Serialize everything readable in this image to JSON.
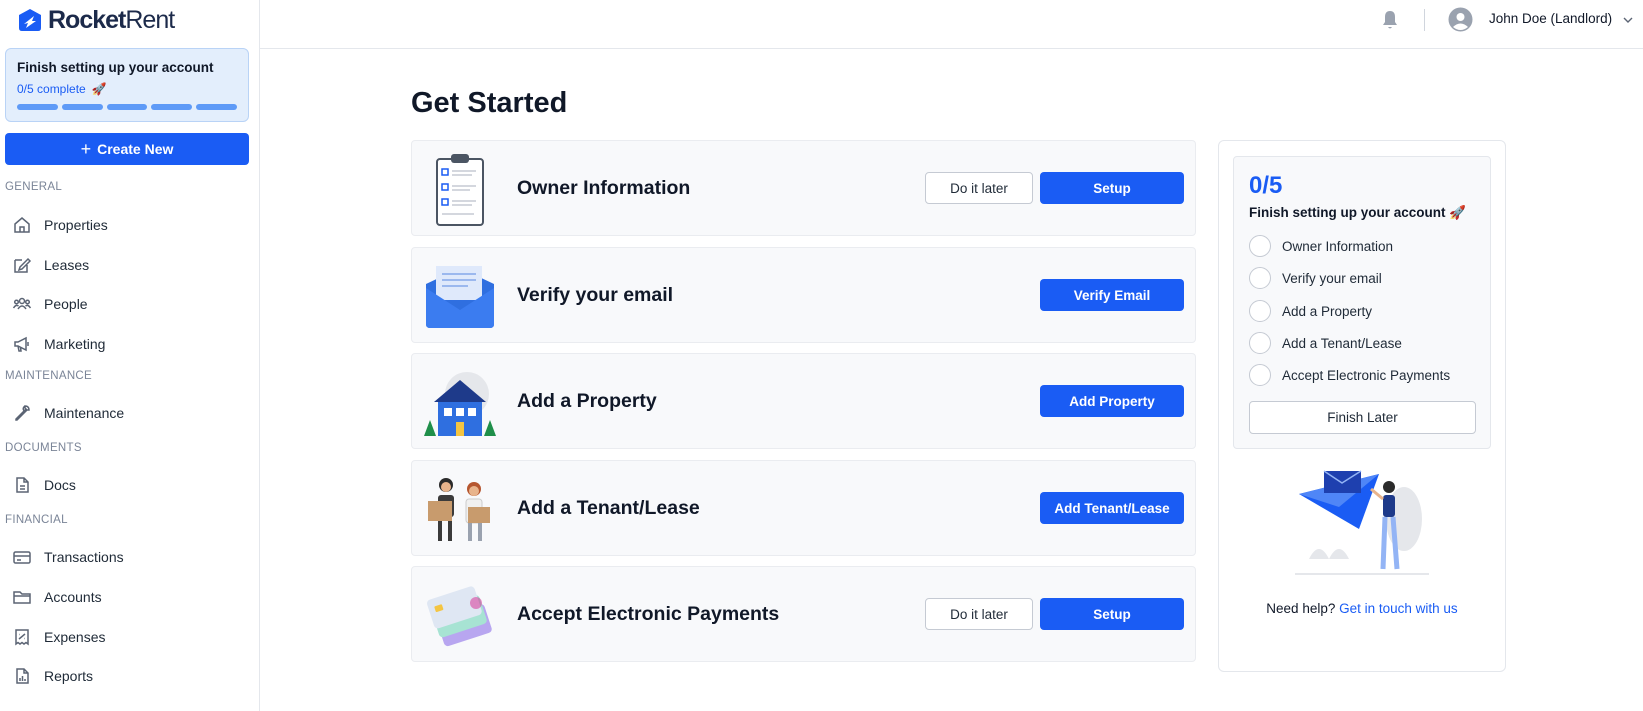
{
  "brand": {
    "name_bold": "Rocket",
    "name_thin": "Rent"
  },
  "setup_card": {
    "title": "Finish setting up your account",
    "progress_text": "0/5 complete",
    "emoji": "🚀",
    "steps_total": 5,
    "steps_complete": 0
  },
  "create_button": {
    "label": "Create New"
  },
  "sidebar": {
    "sections": [
      {
        "label": "GENERAL"
      },
      {
        "label": "MAINTENANCE"
      },
      {
        "label": "DOCUMENTS"
      },
      {
        "label": "FINANCIAL"
      }
    ],
    "items": [
      {
        "label": "Properties",
        "icon": "home-icon"
      },
      {
        "label": "Leases",
        "icon": "edit-icon"
      },
      {
        "label": "People",
        "icon": "people-icon"
      },
      {
        "label": "Marketing",
        "icon": "megaphone-icon"
      },
      {
        "label": "Maintenance",
        "icon": "wrench-icon"
      },
      {
        "label": "Docs",
        "icon": "document-icon"
      },
      {
        "label": "Transactions",
        "icon": "credit-card-icon"
      },
      {
        "label": "Accounts",
        "icon": "folder-icon"
      },
      {
        "label": "Expenses",
        "icon": "receipt-icon"
      },
      {
        "label": "Reports",
        "icon": "report-icon"
      }
    ]
  },
  "header": {
    "user_name": "John Doe (Landlord)",
    "notification_icon": "bell-icon",
    "avatar_icon": "user-circle-icon"
  },
  "main": {
    "title": "Get Started",
    "tasks": [
      {
        "title": "Owner Information",
        "later_label": "Do it later",
        "action_label": "Setup",
        "illustration": "clipboard-icon"
      },
      {
        "title": "Verify your email",
        "action_label": "Verify Email",
        "illustration": "envelope-icon"
      },
      {
        "title": "Add a Property",
        "action_label": "Add Property",
        "illustration": "house-icon"
      },
      {
        "title": "Add a Tenant/Lease",
        "action_label": "Add Tenant/Lease",
        "illustration": "people-boxes-icon"
      },
      {
        "title": "Accept Electronic Payments",
        "later_label": "Do it later",
        "action_label": "Setup",
        "illustration": "cards-icon"
      }
    ]
  },
  "progress_panel": {
    "count": "0/5",
    "subtitle": "Finish setting up your account 🚀",
    "items": [
      {
        "label": "Owner Information",
        "checked": false
      },
      {
        "label": "Verify your email",
        "checked": false
      },
      {
        "label": "Add a Property",
        "checked": false
      },
      {
        "label": "Add a Tenant/Lease",
        "checked": false
      },
      {
        "label": "Accept Electronic Payments",
        "checked": false
      }
    ],
    "finish_later_label": "Finish Later",
    "help_text": "Need help?",
    "help_link": "Get in touch with us"
  },
  "colors": {
    "accent": "#1a5cf4",
    "card_bg": "#f8f9fb",
    "setup_bg": "#e3eefc"
  }
}
